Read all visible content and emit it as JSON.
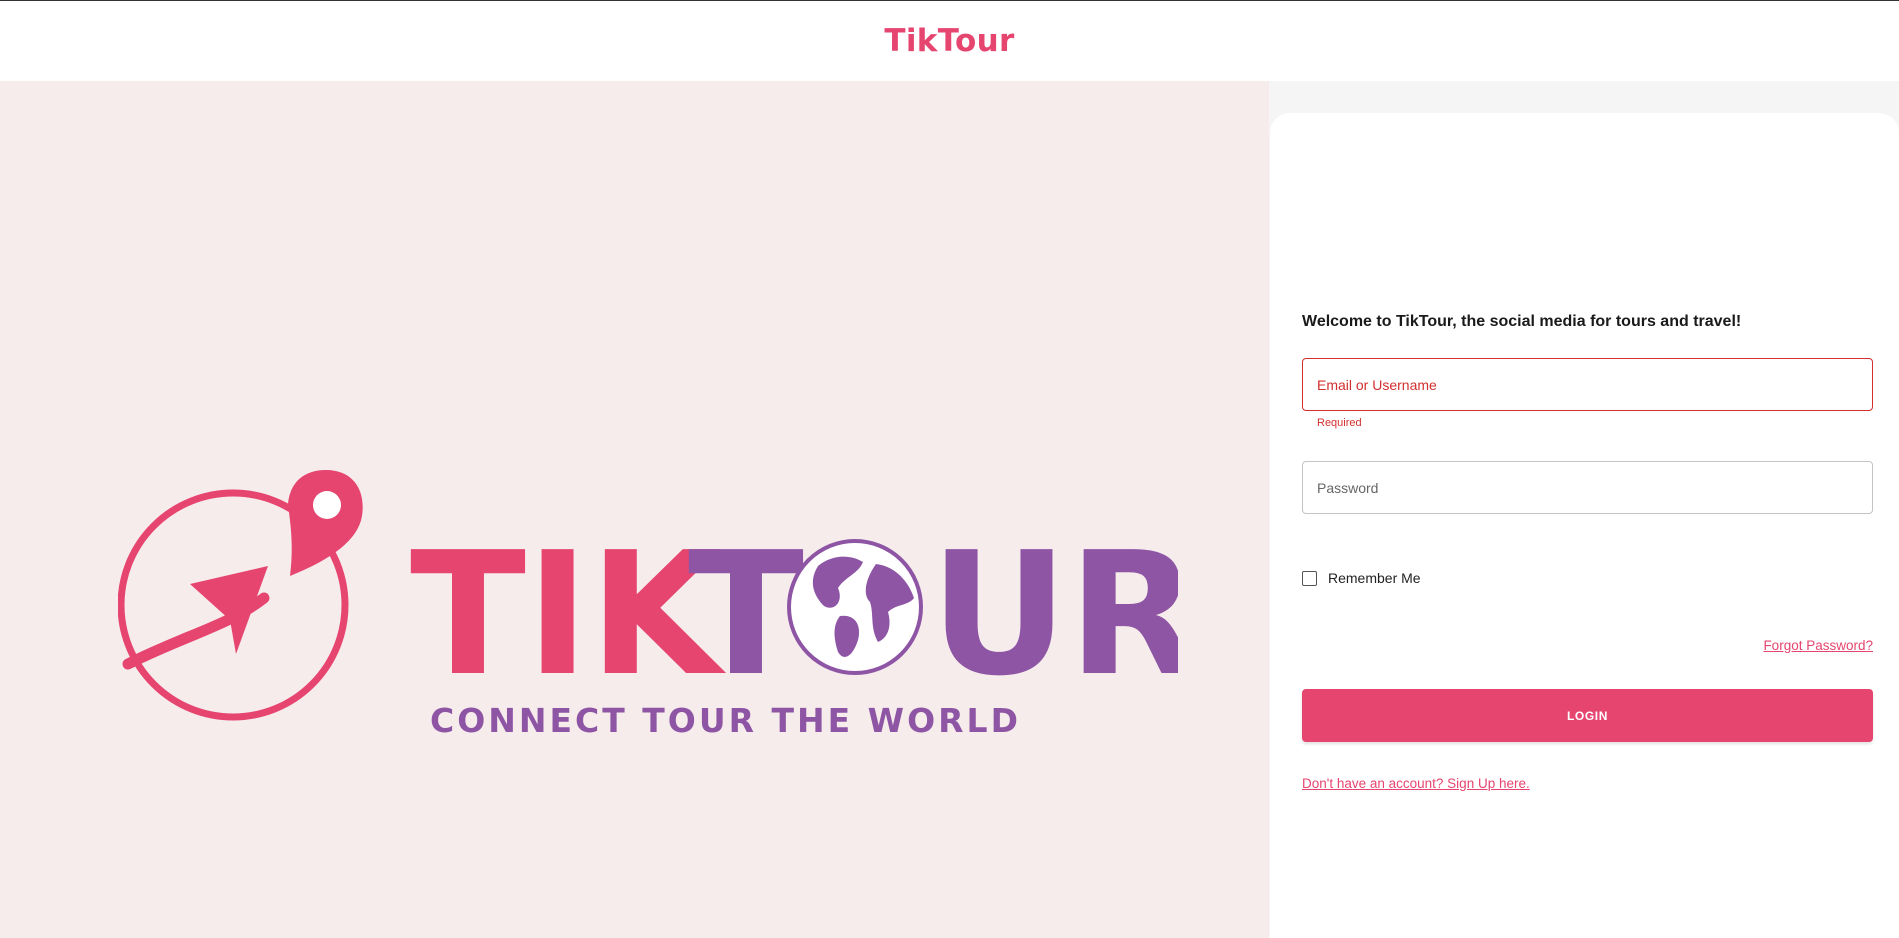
{
  "header": {
    "brand": "TikTour"
  },
  "hero": {
    "logo": {
      "word_part1": "TIK",
      "word_part2_T": "T",
      "word_part2_UR": "UR",
      "tagline": "CONNECT TOUR THE WORLD",
      "icons": [
        "compass-arrow-icon",
        "location-pin-icon",
        "globe-icon"
      ],
      "colors": {
        "pink": "#e5456f",
        "purple": "#8e55a5"
      }
    }
  },
  "login": {
    "welcome": "Welcome to TikTour, the social media for tours and travel!",
    "email": {
      "placeholder": "Email or Username",
      "value": "",
      "helper": "Required"
    },
    "password": {
      "placeholder": "Password",
      "value": ""
    },
    "remember_label": "Remember Me",
    "remember_checked": false,
    "forgot_label": "Forgot Password?",
    "login_label": "LOGIN",
    "signup_label": "Don't have an account? Sign Up here."
  },
  "colors": {
    "accent": "#e5456f",
    "error": "#d32f2f",
    "hero_bg": "#f7ecec"
  }
}
